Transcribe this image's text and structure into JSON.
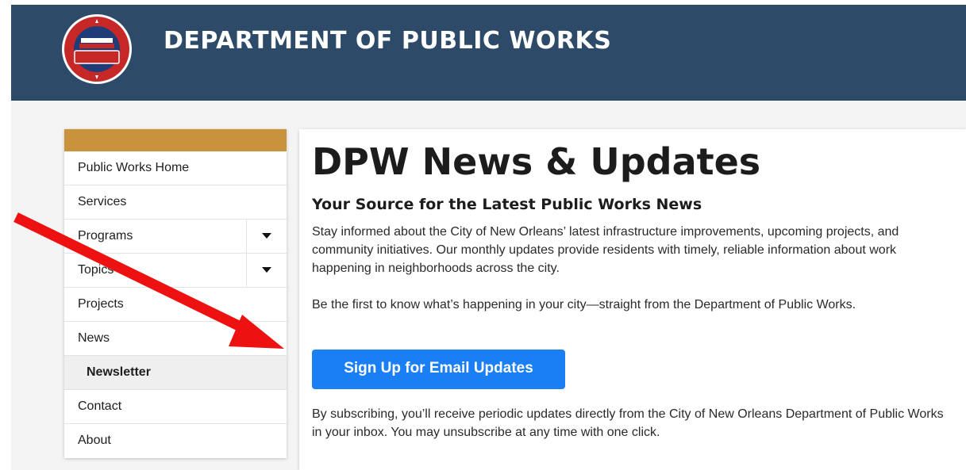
{
  "header": {
    "title": "DEPARTMENT OF PUBLIC WORKS",
    "logo_icon": "dpw-seal-logo",
    "background": "#2d4b69"
  },
  "sidebar": {
    "accent": "#c8933a",
    "items": [
      {
        "label": "Public Works Home"
      },
      {
        "label": "Services"
      },
      {
        "label": "Programs",
        "expandable": true
      },
      {
        "label": "Topics",
        "expandable": true
      },
      {
        "label": "Projects"
      },
      {
        "label": "News"
      },
      {
        "label": "Newsletter",
        "active": true,
        "sub": true
      },
      {
        "label": "Contact"
      },
      {
        "label": "About"
      }
    ]
  },
  "main": {
    "title": "DPW News & Updates",
    "subtitle": "Your Source for the Latest Public Works News",
    "paragraph1": "Stay informed about the City of New Orleans’ latest infrastructure improvements, upcoming projects, and community initiatives. Our monthly updates provide residents with timely, reliable information about work happening in neighborhoods across the city.",
    "paragraph2": "Be the first to know what’s happening in your city—straight from the Department of Public Works.",
    "button_label": "Sign Up for Email Updates",
    "button_color": "#1a7ff5",
    "paragraph3": "By subscribing, you’ll receive periodic updates directly from the City of New Orleans Department of Public Works in your inbox. You may unsubscribe at any time with one click."
  },
  "annotation": {
    "icon": "red-arrow-icon",
    "color": "#ee1111"
  }
}
